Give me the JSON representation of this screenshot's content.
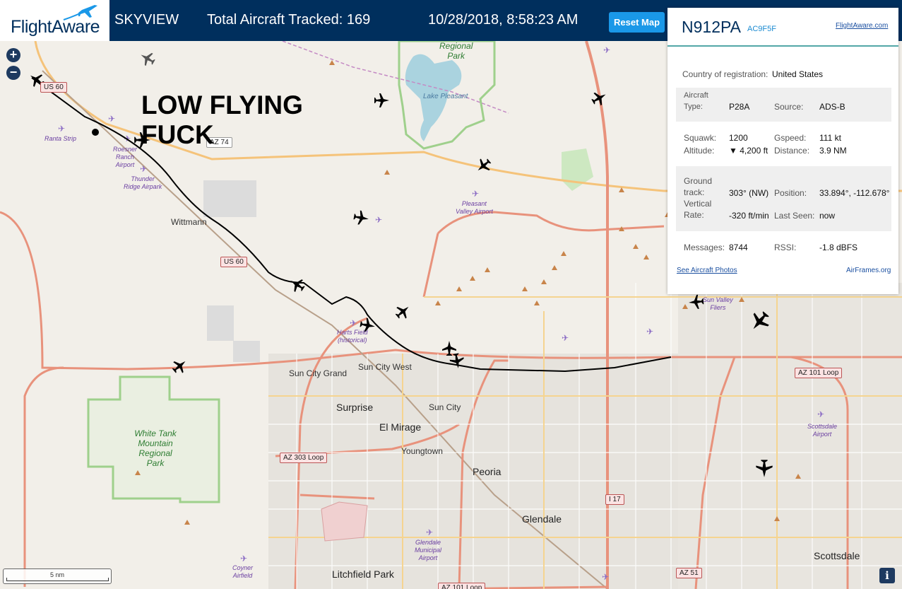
{
  "header": {
    "logo_text": "FlightAware",
    "app_title": "SKYVIEW",
    "tracked": "Total Aircraft Tracked: 169",
    "timestamp": "10/28/2018, 8:58:23 AM",
    "reset_label": "Reset Map"
  },
  "map": {
    "zoom_in": "+",
    "zoom_out": "−",
    "annotation_line1": "LOW FLYING",
    "annotation_line2": "FUCK",
    "scale_label": "5 nm",
    "info_label": "i",
    "labels": {
      "wittmann": "Wittmann",
      "sun_city_grand": "Sun City Grand",
      "sun_city_west": "Sun City West",
      "surprise": "Surprise",
      "sun_city": "Sun City",
      "el_mirage": "El Mirage",
      "youngtown": "Youngtown",
      "peoria": "Peoria",
      "glendale": "Glendale",
      "litchfield_park": "Litchfield Park",
      "scottsdale": "Scottsdale",
      "lake_pleasant": "Lake Pleasant",
      "regional_park_1": "Regional",
      "regional_park_2": "Park",
      "white_tank_1": "White Tank",
      "white_tank_2": "Mountain",
      "white_tank_3": "Regional",
      "white_tank_4": "Park"
    },
    "airports": {
      "ranta": "Ranta Strip",
      "roesner_1": "Roesner",
      "roesner_2": "Ranch",
      "roesner_3": "Airport",
      "thunder_1": "Thunder",
      "thunder_2": "Ridge Airpark",
      "pleasant_1": "Pleasant",
      "pleasant_2": "Valley Airport",
      "harts_1": "Harts Field",
      "harts_2": "(historical)",
      "sunvalley_1": "Sun Valley",
      "sunvalley_2": "Fliers",
      "scottsdale_1": "Scottsdale",
      "scottsdale_2": "Airport",
      "glendale_1": "Glendale",
      "glendale_2": "Municipal",
      "glendale_3": "Airport",
      "coyner_1": "Coyner",
      "coyner_2": "Airfield"
    },
    "shields": {
      "us60_a": "US 60",
      "us60_b": "US 60",
      "az74": "AZ 74",
      "az303": "AZ 303 Loop",
      "az101_e": "AZ 101 Loop",
      "az101_s": "AZ 101 Loop",
      "i17": "I 17",
      "az51": "AZ 51"
    }
  },
  "panel": {
    "registration": "N912PA",
    "hex": "AC9F5F",
    "fa_link": "FlightAware.com",
    "country_key": "Country of registration:",
    "country_val": "United States",
    "aircraft_type_key_1": "Aircraft",
    "aircraft_type_key_2": "Type:",
    "aircraft_type_val": "P28A",
    "source_key": "Source:",
    "source_val": "ADS-B",
    "squawk_key": "Squawk:",
    "squawk_val": "1200",
    "gspeed_key": "Gspeed:",
    "gspeed_val": "111 kt",
    "altitude_key": "Altitude:",
    "altitude_val": "▼ 4,200 ft",
    "distance_key": "Distance:",
    "distance_val": "3.9 NM",
    "ground_key_1": "Ground",
    "ground_key_2": "track:",
    "ground_val": "303° (NW)",
    "position_key": "Position:",
    "position_val": "33.894°, -112.678°",
    "vrate_key_1": "Vertical",
    "vrate_key_2": "Rate:",
    "vrate_val": "-320 ft/min",
    "lastseen_key": "Last Seen:",
    "lastseen_val": "now",
    "messages_key": "Messages:",
    "messages_val": "8744",
    "rssi_key": "RSSI:",
    "rssi_val": "-1.8 dBFS",
    "photos_link": "See Aircraft Photos",
    "airframes_link": "AirFrames.org"
  },
  "colors": {
    "header_bg": "#002f5d",
    "accent": "#1a98e8",
    "track_line": "#000000",
    "motorway": "#e8927c",
    "primary_road": "#f5c37a",
    "park_border": "#9fd08c",
    "water": "#aad3df"
  }
}
